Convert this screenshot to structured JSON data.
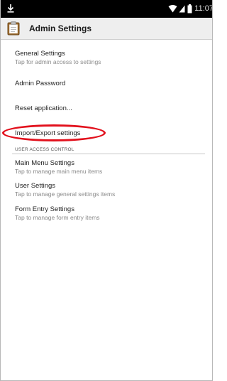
{
  "status_bar": {
    "time": "11:07",
    "left_icon": "download-icon",
    "right_icons": [
      "wifi-icon",
      "cell-signal-icon",
      "battery-icon"
    ]
  },
  "app_bar": {
    "icon": "clipboard-icon",
    "title": "Admin Settings"
  },
  "settings": {
    "general": {
      "title": "General Settings",
      "summary": "Tap for admin access to settings"
    },
    "admin_password": {
      "title": "Admin Password"
    },
    "reset": {
      "title": "Reset application..."
    },
    "import_export": {
      "title": "Import/Export settings"
    },
    "user_access_control": {
      "header": "USER ACCESS CONTROL",
      "items": {
        "main_menu": {
          "title": "Main Menu Settings",
          "summary": "Tap to manage main menu items"
        },
        "user": {
          "title": "User Settings",
          "summary": "Tap to manage general settings items"
        },
        "form_entry": {
          "title": "Form Entry Settings",
          "summary": "Tap to manage form entry items"
        }
      }
    }
  },
  "annotation": {
    "color": "#e2101c",
    "shape": "oval",
    "target": "import-export-settings-item"
  },
  "colors": {
    "status_bar": "#000000",
    "app_bar": "#eeeeee",
    "summary_text": "#8a8a8a"
  }
}
